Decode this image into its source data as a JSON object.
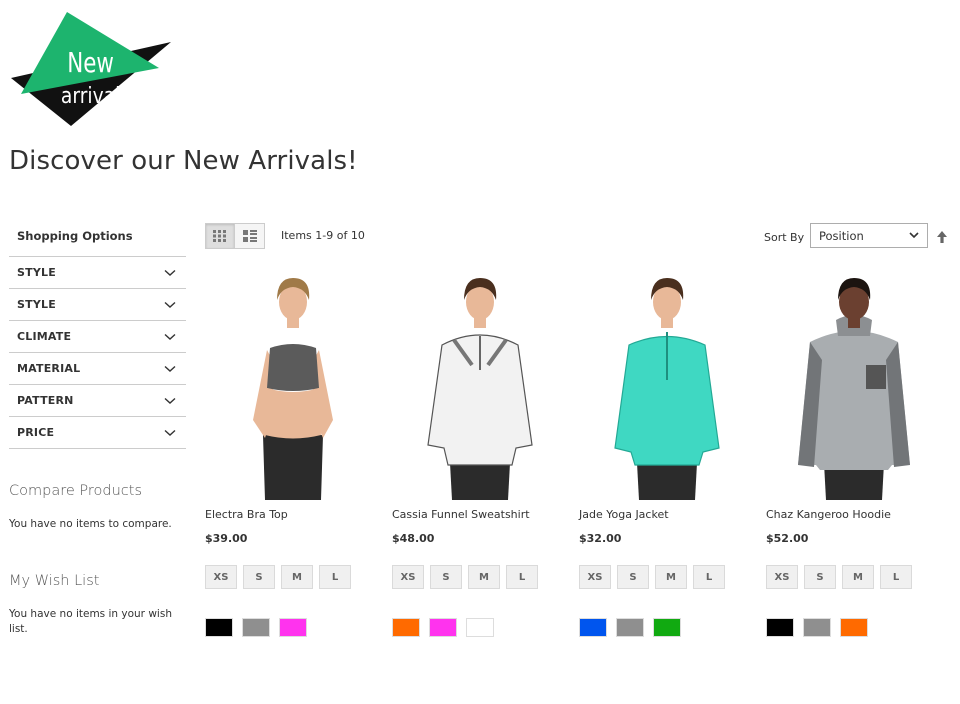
{
  "logo": {
    "line1": "New",
    "line2": "arrival",
    "green": "#1db46e",
    "black": "#111111"
  },
  "page_title": "Discover our New Arrivals!",
  "sidebar": {
    "shopping_options_title": "Shopping Options",
    "filters": [
      "STYLE",
      "STYLE",
      "CLIMATE",
      "MATERIAL",
      "PATTERN",
      "PRICE"
    ],
    "compare": {
      "title": "Compare Products",
      "empty": "You have no items to compare."
    },
    "wishlist": {
      "title": "My Wish List",
      "empty": "You have no items in your wish list."
    }
  },
  "toolbar": {
    "view_modes": [
      "grid-icon",
      "list-icon"
    ],
    "items_count": "Items 1-9 of 10",
    "sort_label": "Sort By",
    "sort_value": "Position",
    "sort_direction_icon": "arrow-up-icon"
  },
  "products": [
    {
      "name": "Electra Bra Top",
      "price": "$39.00",
      "sizes": [
        "XS",
        "S",
        "M",
        "L"
      ],
      "colors": [
        "#000000",
        "#8f8f8f",
        "#ff33ee"
      ],
      "image": "woman-sports-bra-photo"
    },
    {
      "name": "Cassia Funnel Sweatshirt",
      "price": "$48.00",
      "sizes": [
        "XS",
        "S",
        "M",
        "L"
      ],
      "colors": [
        "#ff6a00",
        "#ff33ee",
        "#ffffff"
      ],
      "image": "woman-white-sweatshirt-photo"
    },
    {
      "name": "Jade Yoga Jacket",
      "price": "$32.00",
      "sizes": [
        "XS",
        "S",
        "M",
        "L"
      ],
      "colors": [
        "#0055ee",
        "#8f8f8f",
        "#11aa11"
      ],
      "image": "woman-teal-jacket-photo"
    },
    {
      "name": "Chaz Kangeroo Hoodie",
      "price": "$52.00",
      "sizes": [
        "XS",
        "S",
        "M",
        "L"
      ],
      "colors": [
        "#000000",
        "#8f8f8f",
        "#ff6a00"
      ],
      "image": "man-gray-hoodie-photo"
    }
  ]
}
